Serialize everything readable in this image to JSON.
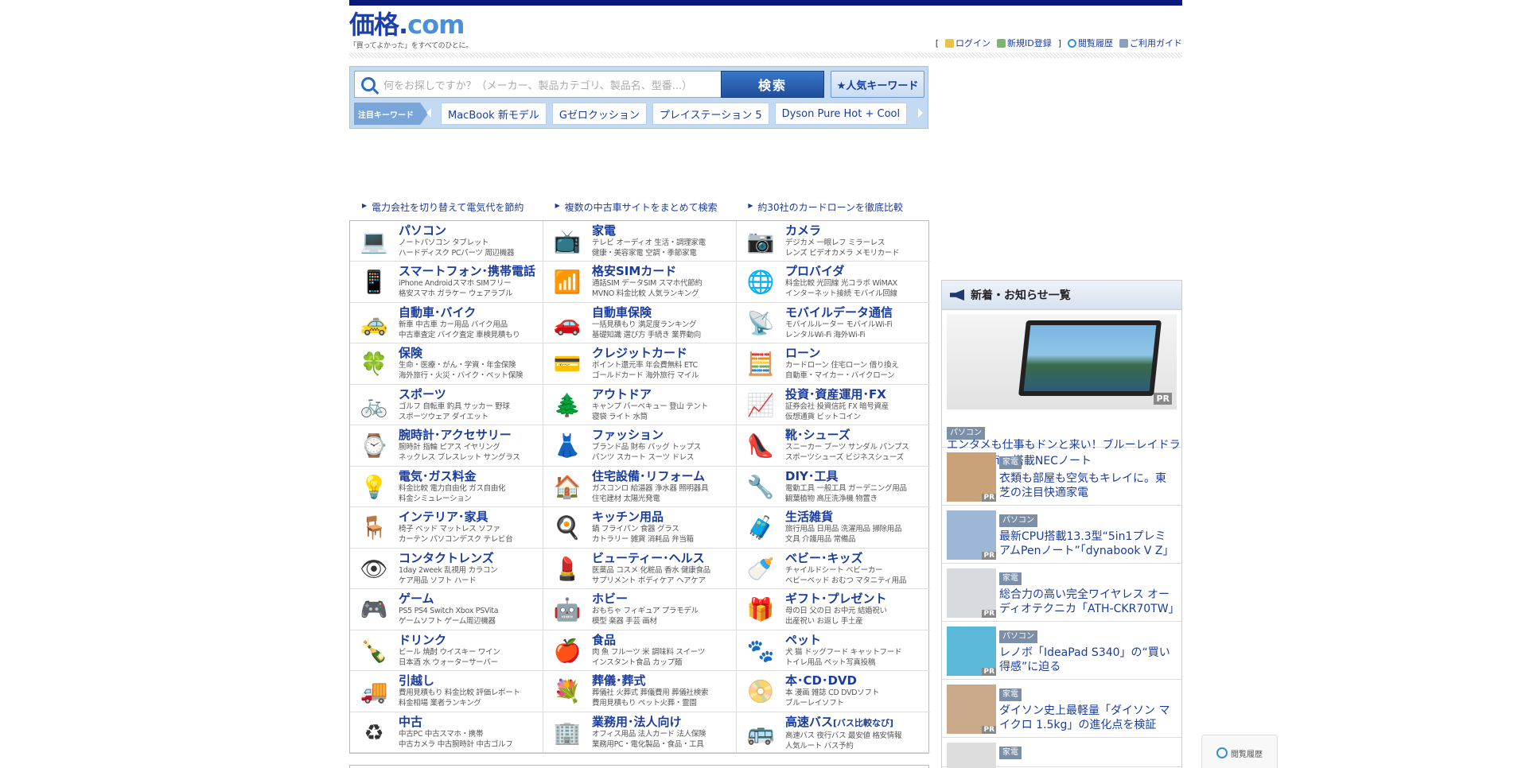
{
  "header": {
    "logo_part1": "価格",
    "logo_part2": ".",
    "logo_part3": "com",
    "tagline": "「買ってよかった」をすべてのひとに。",
    "links": {
      "bracket_open": "[",
      "login": "ログイン",
      "register": "新規ID登録",
      "bracket_close": "]",
      "history": "閲覧履歴",
      "guide": "ご利用ガイド"
    }
  },
  "search": {
    "placeholder": "何をお探しですか？（メーカー、製品カテゴリ、製品名、型番...）",
    "button_label": "検索",
    "popular_button": "★人気キーワード",
    "hot_label": "注目キーワード",
    "hot_keywords": [
      "MacBook 新モデル",
      "Gゼロクッション",
      "プレイステーション 5",
      "Dyson Pure Hot + Cool"
    ]
  },
  "promo_links": [
    "電力会社を切り替えて電気代を節約",
    "複数の中古車サイトをまとめて検索",
    "約30社のカードローンを徹底比較"
  ],
  "categories": [
    {
      "icon": "laptop-icon",
      "glyph": "💻",
      "title": "パソコン",
      "sub1": "ノートパソコン タブレット",
      "sub2": "ハードディスク PCパーツ 周辺機器"
    },
    {
      "icon": "appliance-icon",
      "glyph": "📺",
      "title": "家電",
      "sub1": "テレビ オーディオ 生活・調理家電",
      "sub2": "健康・美容家電 空調・季節家電"
    },
    {
      "icon": "camera-icon",
      "glyph": "📷",
      "title": "カメラ",
      "sub1": "デジカメ 一眼レフ ミラーレス",
      "sub2": "レンズ ビデオカメラ メモリカード"
    },
    {
      "icon": "smartphone-icon",
      "glyph": "📱",
      "title": "スマートフォン･携帯電話",
      "sub1": "iPhone Androidスマホ SIMフリー",
      "sub2": "格安スマホ ガラケー ウェアラブル"
    },
    {
      "icon": "sim-card-icon",
      "glyph": "📶",
      "title": "格安SIMカード",
      "sub1": "通話SIM データSIM スマホ代節約",
      "sub2": "MVNO 料金比較 人気ランキング"
    },
    {
      "icon": "globe-icon",
      "glyph": "🌐",
      "title": "プロバイダ",
      "sub1": "料金比較 光回線 光コラボ WiMAX",
      "sub2": "インターネット接続 モバイル回線"
    },
    {
      "icon": "car-icon",
      "glyph": "🚕",
      "title": "自動車･バイク",
      "sub1": "新車 中古車 カー用品 バイク用品",
      "sub2": "中古車査定 バイク査定 車検見積もり"
    },
    {
      "icon": "car-insurance-icon",
      "glyph": "🚗",
      "title": "自動車保険",
      "sub1": "一括見積もり 満足度ランキング",
      "sub2": "基礎知識 選び方 手続き 業界動向"
    },
    {
      "icon": "wifi-icon",
      "glyph": "📡",
      "title": "モバイルデータ通信",
      "sub1": "モバイルルーター モバイルWi-Fi",
      "sub2": "レンタルWi-Fi 海外Wi-Fi"
    },
    {
      "icon": "clover-icon",
      "glyph": "🍀",
      "title": "保険",
      "sub1": "生命・医療・がん・学資・年金保険",
      "sub2": "海外旅行・火災・バイク・ペット保険"
    },
    {
      "icon": "credit-card-icon",
      "glyph": "💳",
      "title": "クレジットカード",
      "sub1": "ポイント還元率 年会費無料 ETC",
      "sub2": "ゴールドカード 海外旅行 マイル"
    },
    {
      "icon": "calculator-icon",
      "glyph": "🧮",
      "title": "ローン",
      "sub1": "カードローン 住宅ローン 借り換え",
      "sub2": "自動車・マイカー・バイクローン"
    },
    {
      "icon": "bicycle-icon",
      "glyph": "🚲",
      "title": "スポーツ",
      "sub1": "ゴルフ 自転車 釣具 サッカー 野球",
      "sub2": "スポーツウェア ダイエット"
    },
    {
      "icon": "tree-icon",
      "glyph": "🌲",
      "title": "アウトドア",
      "sub1": "キャンプ バーベキュー 登山 テント",
      "sub2": "寝袋 ライト 水筒"
    },
    {
      "icon": "chart-icon",
      "glyph": "📈",
      "title": "投資･資産運用･FX",
      "sub1": "証券会社 投資信託 FX 暗号資産",
      "sub2": "仮想通貨 ビットコイン"
    },
    {
      "icon": "watch-icon",
      "glyph": "⌚",
      "title": "腕時計･アクセサリー",
      "sub1": "腕時計 指輪 ピアス イヤリング",
      "sub2": "ネックレス ブレスレット サングラス"
    },
    {
      "icon": "dress-icon",
      "glyph": "👗",
      "title": "ファッション",
      "sub1": "ブランド品 財布 バッグ トップス",
      "sub2": "パンツ スカート スーツ ドレス"
    },
    {
      "icon": "shoe-icon",
      "glyph": "👠",
      "title": "靴･シューズ",
      "sub1": "スニーカー ブーツ サンダル パンプス",
      "sub2": "スポーツシューズ ビジネスシューズ"
    },
    {
      "icon": "bulb-icon",
      "glyph": "💡",
      "title": "電気･ガス料金",
      "sub1": "料金比較 電力自由化 ガス自由化",
      "sub2": "料金シミュレーション"
    },
    {
      "icon": "house-icon",
      "glyph": "🏠",
      "title": "住宅設備･リフォーム",
      "sub1": "ガスコンロ 給湯器 浄水器 照明器具",
      "sub2": "住宅建材 太陽光発電"
    },
    {
      "icon": "drill-icon",
      "glyph": "🔧",
      "title": "DIY･工具",
      "sub1": "電動工具 一般工具 ガーデニング用品",
      "sub2": "観葉植物 高圧洗浄機 物置き"
    },
    {
      "icon": "chair-icon",
      "glyph": "🪑",
      "title": "インテリア･家具",
      "sub1": "椅子 ベッド マットレス ソファ",
      "sub2": "カーテン パソコンデスク テレビ台"
    },
    {
      "icon": "pot-icon",
      "glyph": "🍳",
      "title": "キッチン用品",
      "sub1": "鍋 フライパン 食器 グラス",
      "sub2": "カトラリー 雑貨 消耗品 弁当箱"
    },
    {
      "icon": "suitcase-icon",
      "glyph": "🧳",
      "title": "生活雑貨",
      "sub1": "旅行用品 日用品 洗濯用品 掃除用品",
      "sub2": "文具 介護用品 常備品"
    },
    {
      "icon": "contact-lens-icon",
      "glyph": "👁",
      "title": "コンタクトレンズ",
      "sub1": "1day 2week 乱視用 カラコン",
      "sub2": "ケア用品 ソフト ハード"
    },
    {
      "icon": "cosmetics-icon",
      "glyph": "💄",
      "title": "ビューティー･ヘルス",
      "sub1": "医薬品 コスメ 化粧品 香水 健康食品",
      "sub2": "サプリメント ボディケア ヘアケア"
    },
    {
      "icon": "stroller-icon",
      "glyph": "🍼",
      "title": "ベビー･キッズ",
      "sub1": "チャイルドシート ベビーカー",
      "sub2": "ベビーベッド おむつ マタニティ用品"
    },
    {
      "icon": "gamepad-icon",
      "glyph": "🎮",
      "title": "ゲーム",
      "sub1": "PS5 PS4 Switch Xbox PSVita",
      "sub2": "ゲームソフト ゲーム周辺機器"
    },
    {
      "icon": "robot-toy-icon",
      "glyph": "🤖",
      "title": "ホビー",
      "sub1": "おもちゃ フィギュア プラモデル",
      "sub2": "模型 楽器 手芸 画材"
    },
    {
      "icon": "gift-icon",
      "glyph": "🎁",
      "title": "ギフト･プレゼント",
      "sub1": "母の日 父の日 お中元 結婚祝い",
      "sub2": "出産祝い お返し 手土産"
    },
    {
      "icon": "drink-icon",
      "glyph": "🍾",
      "title": "ドリンク",
      "sub1": "ビール 焼酎 ウイスキー ワイン",
      "sub2": "日本酒 水 ウォーターサーバー"
    },
    {
      "icon": "food-icon",
      "glyph": "🍎",
      "title": "食品",
      "sub1": "肉 魚 フルーツ 米 調味料 スイーツ",
      "sub2": "インスタント食品 カップ麺"
    },
    {
      "icon": "paw-icon",
      "glyph": "🐾",
      "title": "ペット",
      "sub1": "犬 猫 ドッグフード キャットフード",
      "sub2": "トイレ用品 ペット写真投稿"
    },
    {
      "icon": "truck-icon",
      "glyph": "🚚",
      "title": "引越し",
      "sub1": "費用見積もり 料金比較 評価レポート",
      "sub2": "料金相場 業者ランキング"
    },
    {
      "icon": "lily-icon",
      "glyph": "💐",
      "title": "葬儀･葬式",
      "sub1": "葬儀社 火葬式 葬儀費用 葬儀社検索",
      "sub2": "費用見積もり ペット火葬・霊園"
    },
    {
      "icon": "book-cd-icon",
      "glyph": "📀",
      "title": "本･CD･DVD",
      "sub1": "本 漫画 雑誌 CD DVDソフト",
      "sub2": "ブルーレイソフト"
    },
    {
      "icon": "used-icon",
      "glyph": "♻",
      "title": "中古",
      "sub1": "中古PC 中古スマホ・携帯",
      "sub2": "中古カメラ 中古腕時計 中古ゴルフ"
    },
    {
      "icon": "building-icon",
      "glyph": "🏢",
      "title": "業務用･法人向け",
      "sub1": "オフィス用品 法人カード 法人保険",
      "sub2": "業務用PC・電化製品・食品・工具"
    },
    {
      "icon": "bus-icon",
      "glyph": "🚌",
      "title": "高速バス",
      "title_small": "[バス比較なび]",
      "sub1": "高速バス 夜行バス 最安値 格安情報",
      "sub2": "人気ルート バス予約"
    }
  ],
  "news": {
    "heading": "新着・お知らせ一覧",
    "feature": {
      "category": "パソコン",
      "pr": "PR",
      "text": "エンタメも仕事もドンと来い！ブルーレイドライブ＆Office搭載NECノート"
    },
    "items": [
      {
        "category": "家電",
        "pr": "PR",
        "text": "衣類も部屋も空気もキレイに。東芝の注目快適家電",
        "thumb_color": "#c9a27a"
      },
      {
        "category": "パソコン",
        "pr": "PR",
        "text": "最新CPU搭載13.3型“5in1プレミアムPenノート”「dynabook V Z」",
        "thumb_color": "#9fb7d6"
      },
      {
        "category": "家電",
        "pr": "PR",
        "text": "総合力の高い完全ワイヤレス オーディオテクニカ「ATH-CKR70TW」",
        "thumb_color": "#d7dbe0"
      },
      {
        "category": "パソコン",
        "pr": "PR",
        "text": "レノボ「IdeaPad S340」の“買い得感”に迫る",
        "thumb_color": "#5ab9d6"
      },
      {
        "category": "家電",
        "pr": "PR",
        "text": "ダイソン史上最軽量「ダイソン マイクロ 1.5kg」の進化点を検証",
        "thumb_color": "#caa88a"
      },
      {
        "category": "家電",
        "pr": "",
        "text": "",
        "thumb_color": "#ddd"
      }
    ]
  },
  "history_button": "閲覧履歴",
  "colors": {
    "brand_navy": "#0a1a7a",
    "link_blue": "#1a3c9c",
    "search_bg": "#c4daf3"
  }
}
